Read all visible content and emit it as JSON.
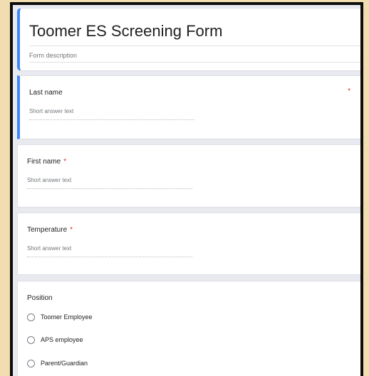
{
  "form": {
    "title": "Toomer ES Screening Form",
    "description_placeholder": "Form description"
  },
  "questions": [
    {
      "label": "Last name",
      "required": true,
      "answer_placeholder": "Short answer text"
    },
    {
      "label": "First name",
      "required": true,
      "answer_placeholder": "Short answer text"
    },
    {
      "label": "Temperature",
      "required": true,
      "answer_placeholder": "Short answer text"
    },
    {
      "label": "Position",
      "required": false,
      "options": [
        "Toomer Employee",
        "APS employee",
        "Parent/Guardian"
      ]
    }
  ],
  "required_mark": "*",
  "colors": {
    "page_background": "#f1ddb0",
    "frame_border": "#0d0d0d",
    "canvas": "#e8eaf0",
    "active_accent": "#4285f4",
    "required_star": "#d93025"
  }
}
